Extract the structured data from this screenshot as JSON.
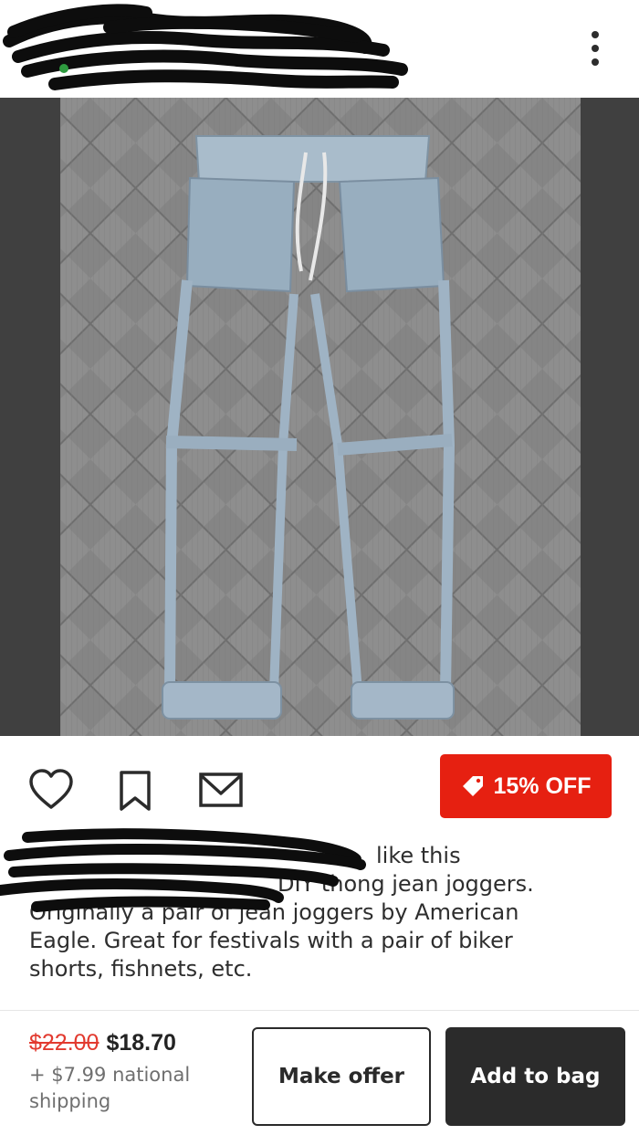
{
  "header": {
    "menu_icon": "more-vertical-icon"
  },
  "photo": {
    "alt": "DIY thong jean joggers on a grey quilted blanket",
    "carousel": {
      "count": 3,
      "active": 0
    }
  },
  "actions": {
    "like_icon": "heart-icon",
    "save_icon": "bookmark-icon",
    "share_icon": "envelope-icon",
    "discount_label": "15% OFF",
    "discount_icon": "tag-icon",
    "discount_color": "#e62011"
  },
  "description": {
    "line1": "like this",
    "line2": "DIY thong jean joggers.",
    "line3": "Originally a pair of jean joggers by American",
    "line4": "Eagle. Great for festivals with a pair of biker",
    "line5": "shorts, fishnets, etc."
  },
  "purchase": {
    "old_price": "$22.00",
    "new_price": "$18.70",
    "shipping_line1": "+ $7.99 national",
    "shipping_line2": "shipping",
    "make_offer_label": "Make offer",
    "add_to_bag_label": "Add to bag",
    "accent_color": "#e23a2f"
  }
}
